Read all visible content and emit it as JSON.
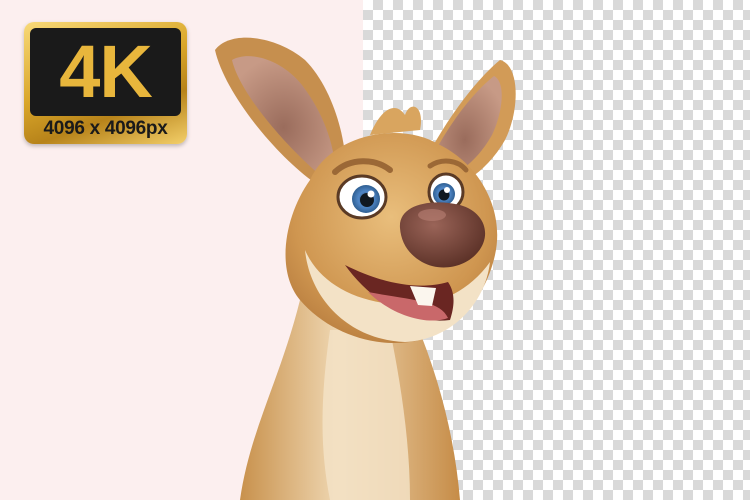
{
  "badge": {
    "title": "4K",
    "resolution": "4096 x 4096px"
  },
  "illustration": {
    "subject": "kangaroo-cartoon",
    "colors": {
      "fur": "#d9a55f",
      "fur_light": "#f3e2c6",
      "nose": "#6b3e33",
      "eye": "#4f86c6",
      "badge_gold": "#e8b63c",
      "badge_dark": "#1a1a1a",
      "left_bg": "#fcefef"
    }
  }
}
